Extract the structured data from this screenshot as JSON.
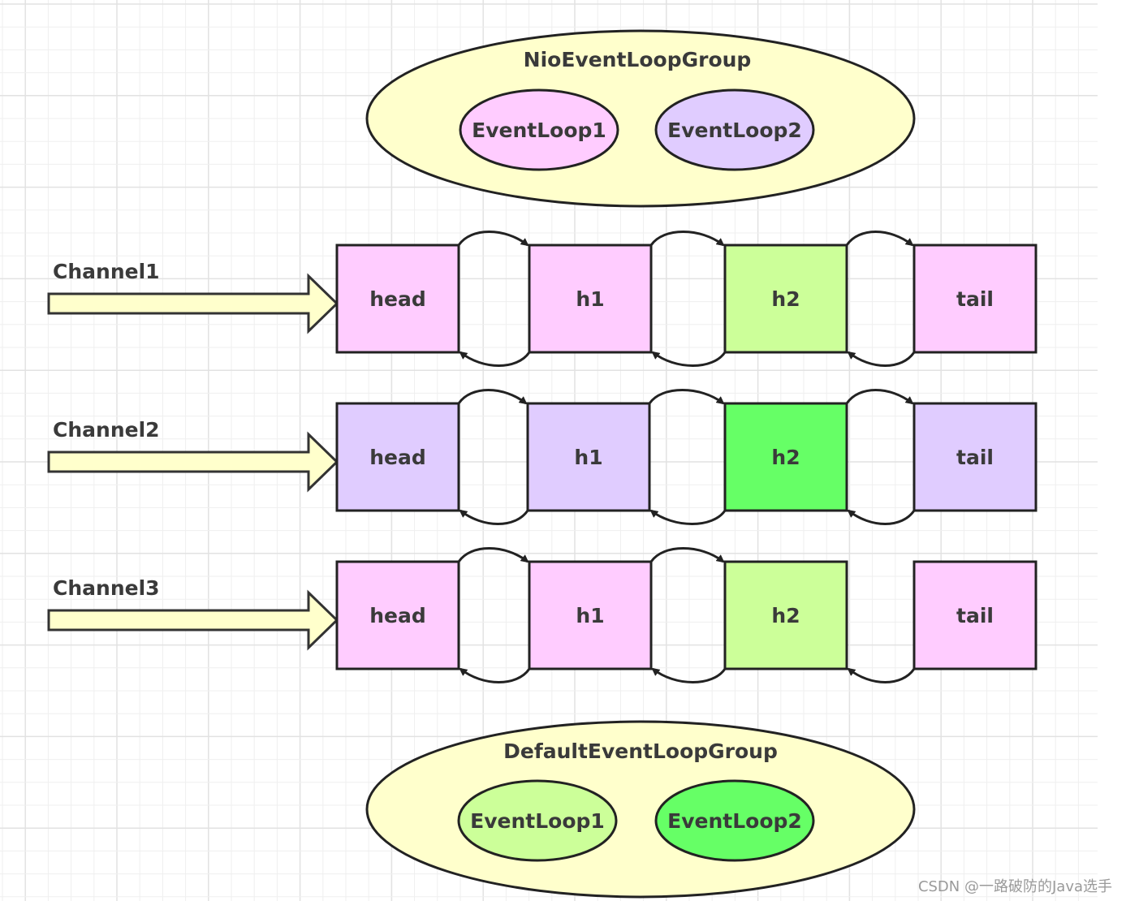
{
  "top_group": {
    "title": "NioEventLoopGroup",
    "fill": "#FFFFCC",
    "loops": [
      {
        "label": "EventLoop1",
        "fill": "#FFCCFF"
      },
      {
        "label": "EventLoop2",
        "fill": "#E0CCFF"
      }
    ]
  },
  "bottom_group": {
    "title": "DefaultEventLoopGroup",
    "fill": "#FFFFCC",
    "loops": [
      {
        "label": "EventLoop1",
        "fill": "#CCFF99"
      },
      {
        "label": "EventLoop2",
        "fill": "#66FF66"
      }
    ]
  },
  "channels": [
    {
      "label": "Channel1",
      "nodes": [
        {
          "label": "head",
          "fill": "#FFCCFF"
        },
        {
          "label": "h1",
          "fill": "#FFCCFF"
        },
        {
          "label": "h2",
          "fill": "#CCFF99"
        },
        {
          "label": "tail",
          "fill": "#FFCCFF"
        }
      ],
      "h2_to_tail_forward": true
    },
    {
      "label": "Channel2",
      "nodes": [
        {
          "label": "head",
          "fill": "#E0CCFF"
        },
        {
          "label": "h1",
          "fill": "#E0CCFF"
        },
        {
          "label": "h2",
          "fill": "#66FF66"
        },
        {
          "label": "tail",
          "fill": "#E0CCFF"
        }
      ],
      "h2_to_tail_forward": true
    },
    {
      "label": "Channel3",
      "nodes": [
        {
          "label": "head",
          "fill": "#FFCCFF"
        },
        {
          "label": "h1",
          "fill": "#FFCCFF"
        },
        {
          "label": "h2",
          "fill": "#CCFF99"
        },
        {
          "label": "tail",
          "fill": "#FFCCFF"
        }
      ],
      "h2_to_tail_forward": false
    }
  ],
  "arrow_fill": "#FFFFCC",
  "watermark": "CSDN @一路破防的Java选手"
}
